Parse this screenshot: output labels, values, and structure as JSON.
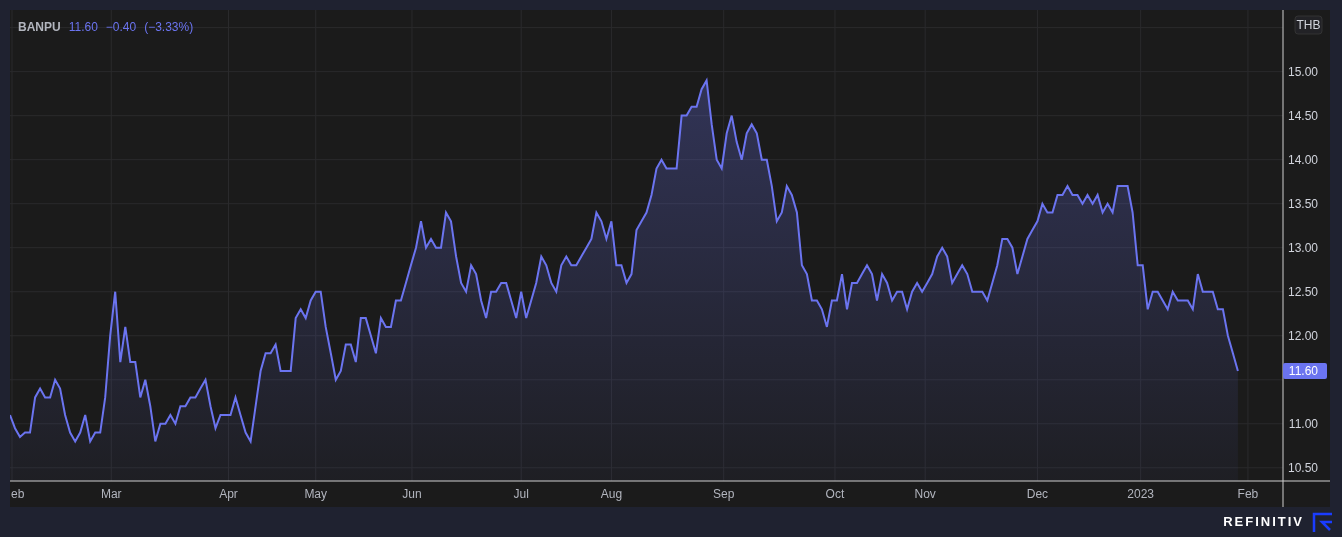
{
  "legend": {
    "price": "11.60",
    "change": "−0.40",
    "change_percent": "(−3.33%)"
  },
  "currency": "THB",
  "last_price_label": "11.60",
  "time_axis": [
    "eb",
    "Mar",
    "Apr",
    "May",
    "Jun",
    "Jul",
    "Aug",
    "Sep",
    "Oct",
    "Nov",
    "Dec",
    "2023",
    "Feb"
  ],
  "chart_data": {
    "type": "area",
    "grid": true,
    "ylim": [
      10.35,
      15.7
    ],
    "yticks": [
      {
        "value": 10.5,
        "label": "10.50"
      },
      {
        "value": 11,
        "label": "11.00"
      },
      {
        "value": 12,
        "label": "12.00"
      },
      {
        "value": 12.5,
        "label": "12.50"
      },
      {
        "value": 13,
        "label": "13.00"
      },
      {
        "value": 13.5,
        "label": "13.50"
      },
      {
        "value": 14,
        "label": "14.00"
      },
      {
        "value": 14.5,
        "label": "14.50"
      },
      {
        "value": 15,
        "label": "15.00"
      }
    ],
    "series": [
      {
        "name": "BANPU",
        "color": "#6b74f0",
        "values": [
          11.1,
          10.95,
          10.85,
          10.9,
          10.9,
          11.3,
          11.4,
          11.3,
          11.3,
          11.5,
          11.4,
          11.1,
          10.9,
          10.8,
          10.9,
          11.1,
          10.8,
          10.9,
          10.9,
          11.3,
          12.0,
          12.5,
          11.7,
          12.1,
          11.7,
          11.7,
          11.3,
          11.5,
          11.2,
          10.8,
          11.0,
          11.0,
          11.1,
          11.0,
          11.2,
          11.2,
          11.3,
          11.3,
          11.4,
          11.5,
          11.2,
          10.95,
          11.1,
          11.1,
          11.1,
          11.3,
          11.1,
          10.9,
          10.8,
          11.2,
          11.6,
          11.8,
          11.8,
          11.9,
          11.6,
          11.6,
          11.6,
          12.2,
          12.3,
          12.2,
          12.4,
          12.5,
          12.5,
          12.1,
          11.8,
          11.5,
          11.6,
          11.9,
          11.9,
          11.7,
          12.2,
          12.2,
          12.0,
          11.8,
          12.2,
          12.1,
          12.1,
          12.4,
          12.4,
          12.6,
          12.8,
          13.0,
          13.3,
          13.0,
          13.1,
          13.0,
          13.0,
          13.4,
          13.3,
          12.9,
          12.6,
          12.5,
          12.8,
          12.7,
          12.4,
          12.2,
          12.5,
          12.5,
          12.6,
          12.6,
          12.4,
          12.2,
          12.5,
          12.2,
          12.4,
          12.6,
          12.9,
          12.8,
          12.6,
          12.5,
          12.8,
          12.9,
          12.8,
          12.8,
          12.9,
          13.0,
          13.1,
          13.4,
          13.3,
          13.1,
          13.3,
          12.8,
          12.8,
          12.6,
          12.7,
          13.2,
          13.3,
          13.4,
          13.6,
          13.9,
          14.0,
          13.9,
          13.9,
          13.9,
          14.5,
          14.5,
          14.6,
          14.6,
          14.8,
          14.9,
          14.4,
          14.0,
          13.9,
          14.3,
          14.5,
          14.2,
          14.0,
          14.3,
          14.4,
          14.3,
          14.0,
          14.0,
          13.7,
          13.3,
          13.4,
          13.7,
          13.6,
          13.4,
          12.8,
          12.7,
          12.4,
          12.4,
          12.3,
          12.1,
          12.4,
          12.4,
          12.7,
          12.3,
          12.6,
          12.6,
          12.7,
          12.8,
          12.7,
          12.4,
          12.7,
          12.6,
          12.4,
          12.5,
          12.5,
          12.3,
          12.5,
          12.6,
          12.5,
          12.6,
          12.7,
          12.9,
          13.0,
          12.9,
          12.6,
          12.7,
          12.8,
          12.7,
          12.5,
          12.5,
          12.5,
          12.4,
          12.6,
          12.8,
          13.1,
          13.1,
          13.0,
          12.7,
          12.9,
          13.1,
          13.2,
          13.3,
          13.5,
          13.4,
          13.4,
          13.6,
          13.6,
          13.7,
          13.6,
          13.6,
          13.5,
          13.6,
          13.5,
          13.6,
          13.4,
          13.5,
          13.4,
          13.7,
          13.7,
          13.7,
          13.4,
          12.8,
          12.8,
          12.3,
          12.5,
          12.5,
          12.4,
          12.3,
          12.5,
          12.4,
          12.4,
          12.4,
          12.3,
          12.7,
          12.5,
          12.5,
          12.5,
          12.3,
          12.3,
          12.0,
          11.8,
          11.6
        ]
      }
    ]
  },
  "footer": {
    "brand": "REFINITIV"
  }
}
